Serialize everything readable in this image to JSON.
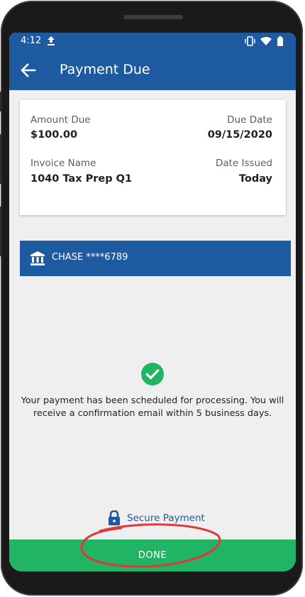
{
  "status_bar": {
    "time": "4:12",
    "icons": [
      "upload-icon",
      "vibrate-icon",
      "wifi-icon",
      "battery-icon"
    ]
  },
  "app_bar": {
    "title": "Payment Due",
    "back_icon": "arrow-back-icon"
  },
  "invoice": {
    "amount_due_label": "Amount Due",
    "amount_due_value": "$100.00",
    "due_date_label": "Due Date",
    "due_date_value": "09/15/2020",
    "invoice_name_label": "Invoice Name",
    "invoice_name_value": "1040 Tax Prep Q1",
    "date_issued_label": "Date Issued",
    "date_issued_value": "Today"
  },
  "bank": {
    "icon": "bank-icon",
    "label": "CHASE ****6789"
  },
  "confirmation": {
    "icon": "check-circle-icon",
    "message": "Your payment has been scheduled for processing. You will receive a confirmation email within 5 business days."
  },
  "secure": {
    "icon": "lock-icon",
    "label": "Secure Payment"
  },
  "done_button": {
    "label": "DONE"
  },
  "colors": {
    "primary": "#1e5aa0",
    "success": "#21b464",
    "background": "#efefef",
    "annotation": "#e0393b"
  }
}
